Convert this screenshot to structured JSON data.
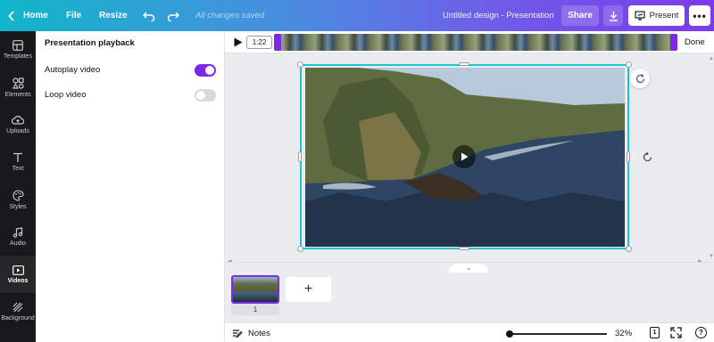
{
  "topbar": {
    "home_label": "Home",
    "file_label": "File",
    "resize_label": "Resize",
    "save_status": "All changes saved",
    "design_title": "Untitled design - Presentation",
    "share_label": "Share",
    "present_label": "Present",
    "more_label": "•••"
  },
  "rail": {
    "items": [
      {
        "label": "Templates",
        "icon": "templates-icon"
      },
      {
        "label": "Elements",
        "icon": "elements-icon"
      },
      {
        "label": "Uploads",
        "icon": "uploads-icon"
      },
      {
        "label": "Text",
        "icon": "text-icon"
      },
      {
        "label": "Styles",
        "icon": "styles-icon"
      },
      {
        "label": "Audio",
        "icon": "audio-icon"
      },
      {
        "label": "Videos",
        "icon": "videos-icon"
      },
      {
        "label": "Background",
        "icon": "background-icon"
      }
    ],
    "active": "Videos"
  },
  "panel": {
    "title": "Presentation playback",
    "autoplay_label": "Autoplay video",
    "autoplay_on": true,
    "loop_label": "Loop video",
    "loop_on": false
  },
  "trim": {
    "duration": "1:22",
    "done_label": "Done"
  },
  "pages": {
    "current_page_number": "1",
    "add_label": "+"
  },
  "bottombar": {
    "notes_label": "Notes",
    "zoom_value": "32%",
    "zoom_fraction": 0.0,
    "page_count": "1",
    "help_label": "?"
  },
  "colors": {
    "accent": "#7d2ae8",
    "selection": "#1cc5d1",
    "rail_bg": "#18191b"
  }
}
